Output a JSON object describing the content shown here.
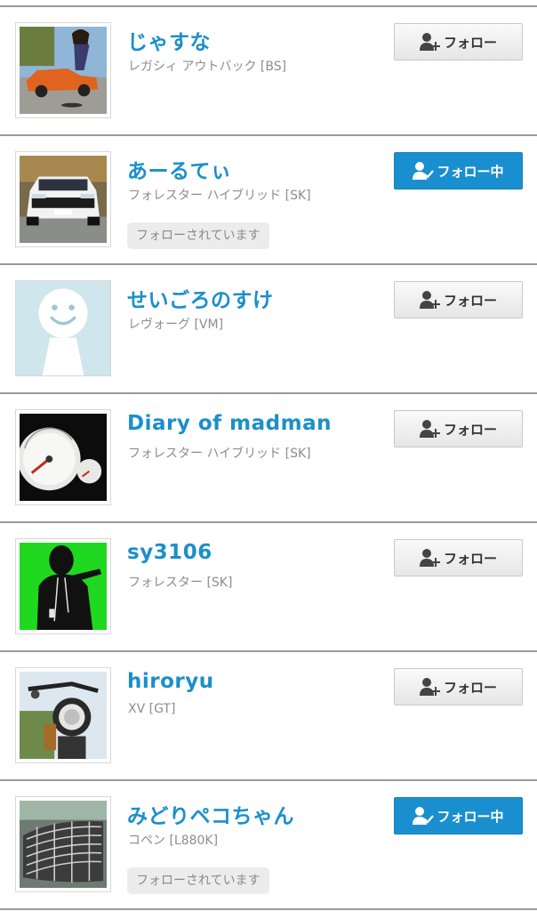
{
  "users": [
    {
      "name": "じゃすな",
      "car": "レガシィ アウトバック [BS]",
      "button": "フォロー",
      "button_state": "follow",
      "follows_you": "",
      "avatar_icon": "orange-car-photo"
    },
    {
      "name": "あーるてぃ",
      "car": "フォレスター ハイブリッド [SK]",
      "button": "フォロー中",
      "button_state": "following",
      "follows_you": "フォローされています",
      "avatar_icon": "white-suv-photo"
    },
    {
      "name": "せいごろのすけ",
      "car": "レヴォーグ [VM]",
      "button": "フォロー",
      "button_state": "follow",
      "follows_you": "",
      "avatar_icon": "default-avatar"
    },
    {
      "name": "Diary of madman",
      "car": "フォレスター ハイブリッド [SK]",
      "button": "フォロー",
      "button_state": "follow",
      "follows_you": "",
      "avatar_icon": "speedometer-photo"
    },
    {
      "name": "sy3106",
      "car": "フォレスター [SK]",
      "button": "フォロー",
      "button_state": "follow",
      "follows_you": "",
      "avatar_icon": "silhouette-green-photo"
    },
    {
      "name": "hiroryu",
      "car": "XV [GT]",
      "button": "フォロー",
      "button_state": "follow",
      "follows_you": "",
      "avatar_icon": "motorcycle-photo"
    },
    {
      "name": "みどりペコちゃん",
      "car": "コペン [L880K]",
      "button": "フォロー中",
      "button_state": "following",
      "follows_you": "フォローされています",
      "avatar_icon": "car-grille-photo"
    }
  ],
  "colors": {
    "name": "#1b8fca",
    "following_button": "#1a8fcf",
    "divider": "#9a9a9a"
  }
}
